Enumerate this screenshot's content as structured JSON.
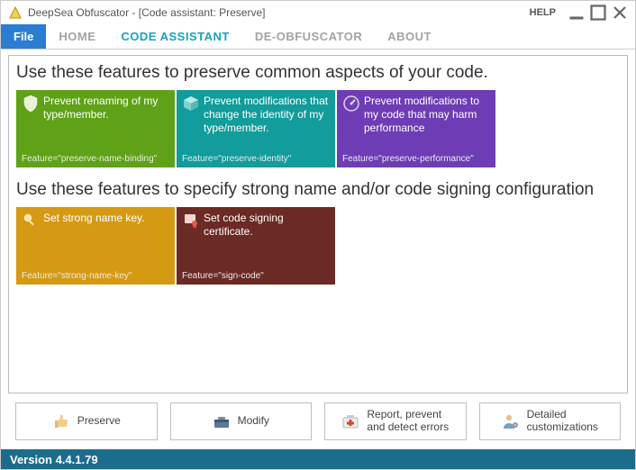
{
  "window": {
    "title": "DeepSea Obfuscator - [Code assistant: Preserve]",
    "help": "HELP"
  },
  "menu": {
    "file": "File",
    "items": [
      {
        "label": "HOME",
        "active": false
      },
      {
        "label": "CODE ASSISTANT",
        "active": true
      },
      {
        "label": "DE-OBFUSCATOR",
        "active": false
      },
      {
        "label": "ABOUT",
        "active": false
      }
    ]
  },
  "sections": {
    "preserve_heading": "Use these features to preserve common aspects of your code.",
    "signing_heading": "Use these features to specify strong name and/or code signing configuration"
  },
  "tiles": {
    "preserve": [
      {
        "title": "Prevent renaming of my type/member.",
        "footer": "Feature=\"preserve-name-binding\"",
        "color": "green",
        "icon": "shield-icon"
      },
      {
        "title": "Prevent modifications that change the identity of my type/member.",
        "footer": "Feature=\"preserve-identity\"",
        "color": "teal",
        "icon": "cube-icon"
      },
      {
        "title": "Prevent modifications to my code that may harm performance",
        "footer": "Feature=\"preserve-performance\"",
        "color": "purple",
        "icon": "gauge-icon"
      }
    ],
    "signing": [
      {
        "title": "Set strong name key.",
        "footer": "Feature=\"strong-name-key\"",
        "color": "orange",
        "icon": "key-icon"
      },
      {
        "title": "Set code signing certificate.",
        "footer": "Feature=\"sign-code\"",
        "color": "maroon",
        "icon": "certificate-icon"
      }
    ]
  },
  "bottom_buttons": [
    {
      "label": "Preserve",
      "icon": "thumbs-up-icon"
    },
    {
      "label": "Modify",
      "icon": "toolbox-icon"
    },
    {
      "label": "Report, prevent\nand detect errors",
      "icon": "firstaid-icon"
    },
    {
      "label": "Detailed\ncustomizations",
      "icon": "user-gear-icon"
    }
  ],
  "status": {
    "version_label": "Version 4.4.1.79"
  }
}
